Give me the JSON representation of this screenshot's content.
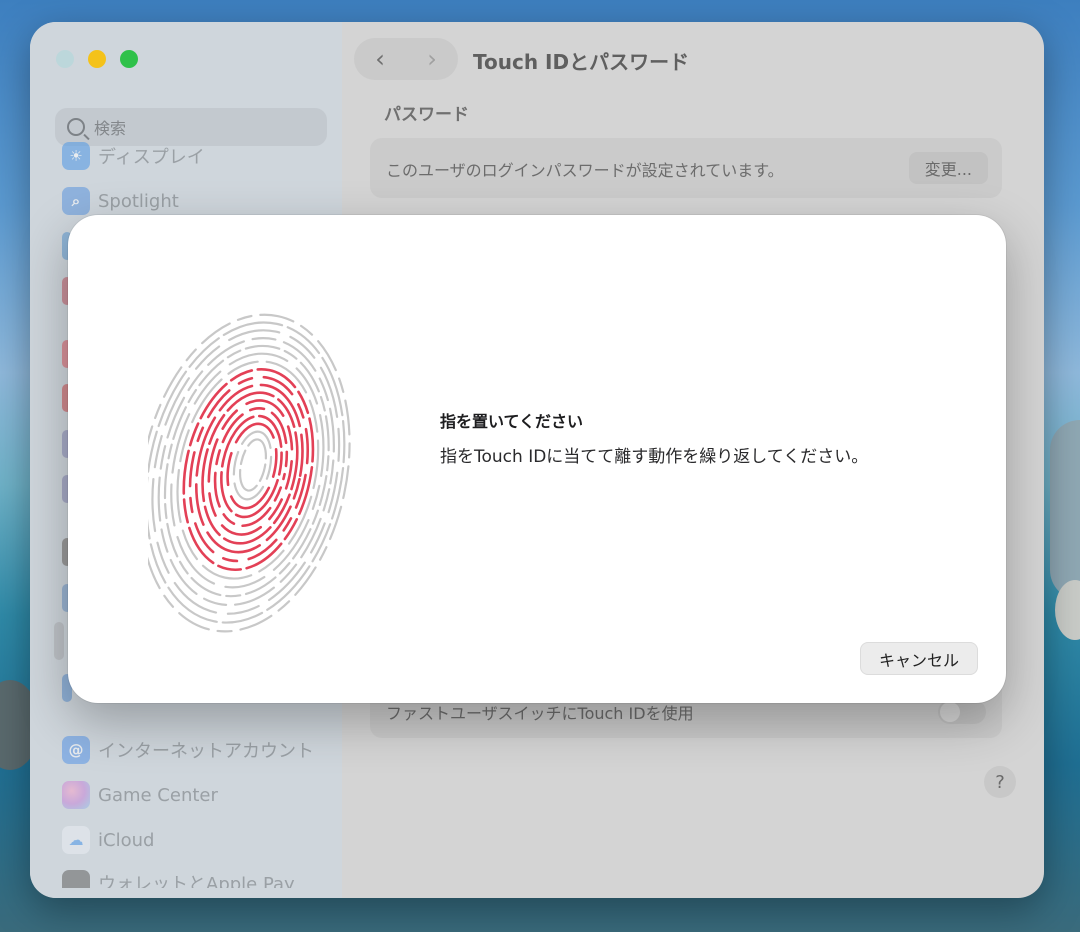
{
  "colors": {
    "accent_fingerprint": "#e34056",
    "fingerprint_inactive": "#c8c8c8",
    "close": "#ff5f57",
    "minimize": "#febc2e",
    "zoom": "#28c840"
  },
  "sidebar": {
    "search_placeholder": "検索",
    "items": [
      {
        "label": "ディスプレイ",
        "icon": "sun-icon",
        "color": "#3b8fe6"
      },
      {
        "label": "Spotlight",
        "icon": "magnifier-icon",
        "color": "#4f8fe0"
      },
      {
        "label": "インターネットアカウント",
        "icon": "at-sign-icon",
        "color": "#3c8ef0"
      },
      {
        "label": "Game Center",
        "icon": "game-center-icon",
        "color": "#d96fb4"
      },
      {
        "label": "iCloud",
        "icon": "cloud-icon",
        "color": "#6aa6e8"
      },
      {
        "label": "ウォレットとApple Pay",
        "icon": "wallet-icon",
        "color": "#3a3a3a"
      }
    ]
  },
  "window": {
    "title": "Touch IDとパスワード",
    "section_password": "パスワード",
    "password_row_text": "このユーザのログインパスワードが設定されています。",
    "change_button": "変更...",
    "fast_user_switch_text": "ファストユーザスイッチにTouch IDを使用",
    "help_label": "?"
  },
  "dialog": {
    "title": "指を置いてください",
    "message": "指をTouch IDに当てて離す動作を繰り返してください。",
    "cancel_button": "キャンセル"
  }
}
